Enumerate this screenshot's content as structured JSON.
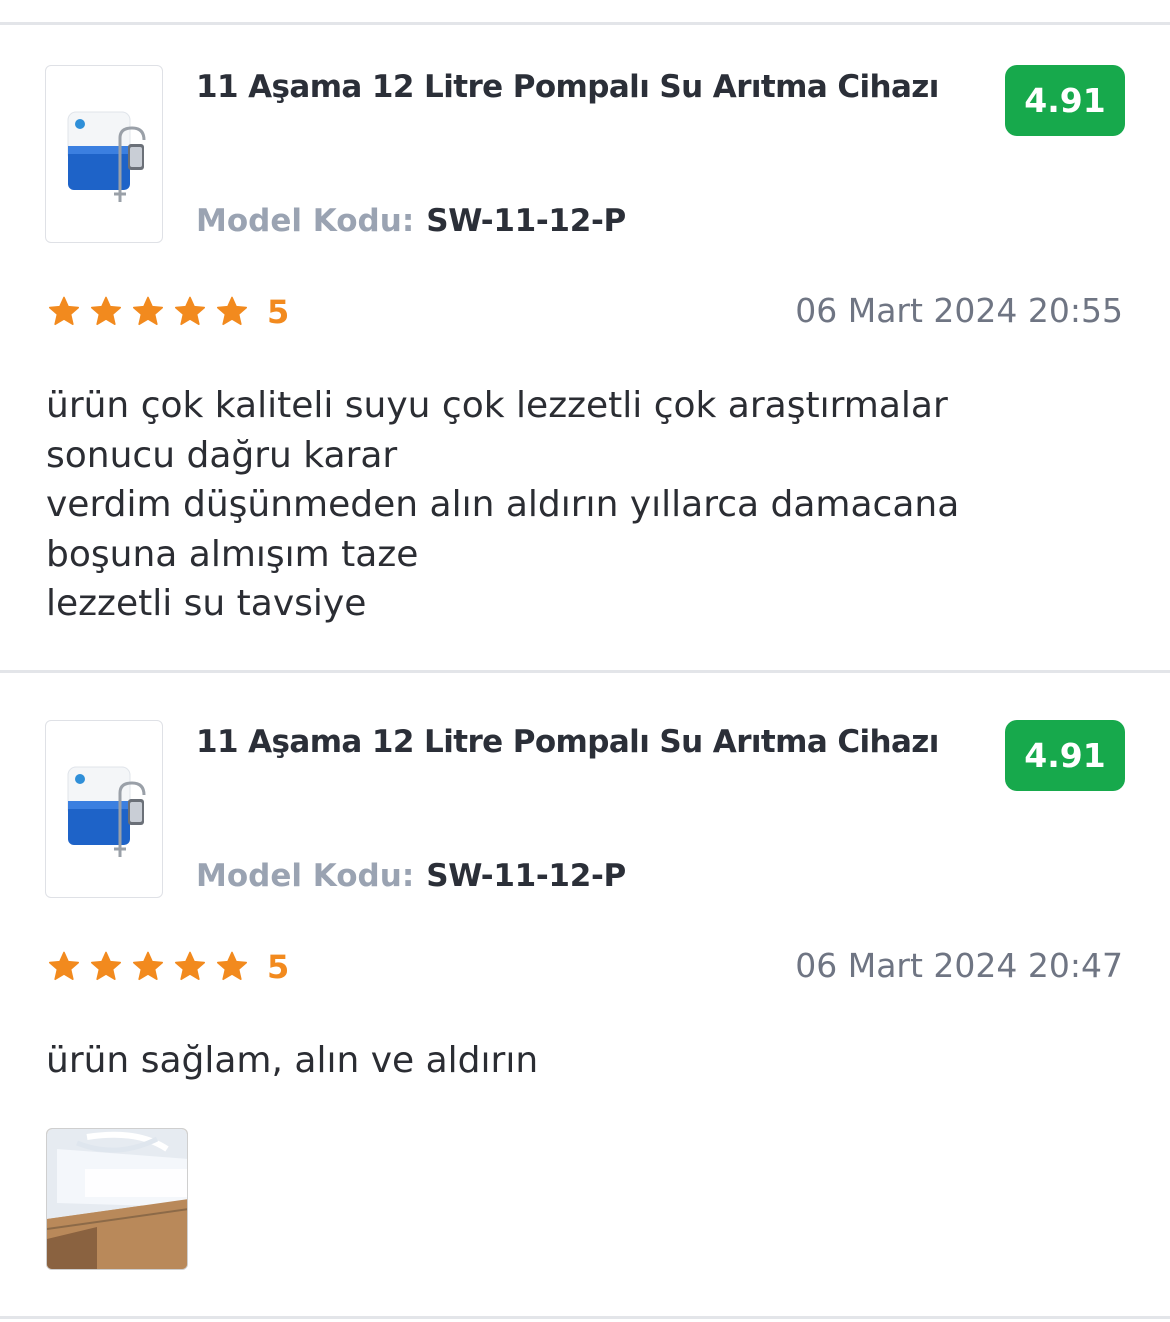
{
  "reviews": [
    {
      "product_title": "11 Aşama 12 Litre Pompalı Su Arıtma Cihazı",
      "model_label": "Model Kodu:",
      "model_code": "SW-11-12-P",
      "score": "4.91",
      "rating": "5",
      "rating_stars": 5,
      "date": "06 Mart 2024 20:55",
      "text_lines": [
        "ürün çok kaliteli suyu çok lezzetli çok araştırmalar",
        "sonucu dağru karar",
        "verdim düşünmeden alın aldırın yıllarca damacana",
        "boşuna almışım taze",
        "lezzetli su tavsiye"
      ]
    },
    {
      "product_title": "11 Aşama 12 Litre Pompalı Su Arıtma Cihazı",
      "model_label": "Model Kodu:",
      "model_code": "SW-11-12-P",
      "score": "4.91",
      "rating": "5",
      "rating_stars": 5,
      "date": "06 Mart 2024 20:47",
      "text_lines": [
        "ürün sağlam, alın ve aldırın"
      ],
      "has_photo": true
    }
  ],
  "colors": {
    "badge": "#17a94c",
    "star": "#f28a1e",
    "muted": "#9aa3b2",
    "divider": "#e3e5e9"
  },
  "icons": {
    "star": "star-icon",
    "product": "water-purifier-image",
    "photo": "review-photo"
  }
}
